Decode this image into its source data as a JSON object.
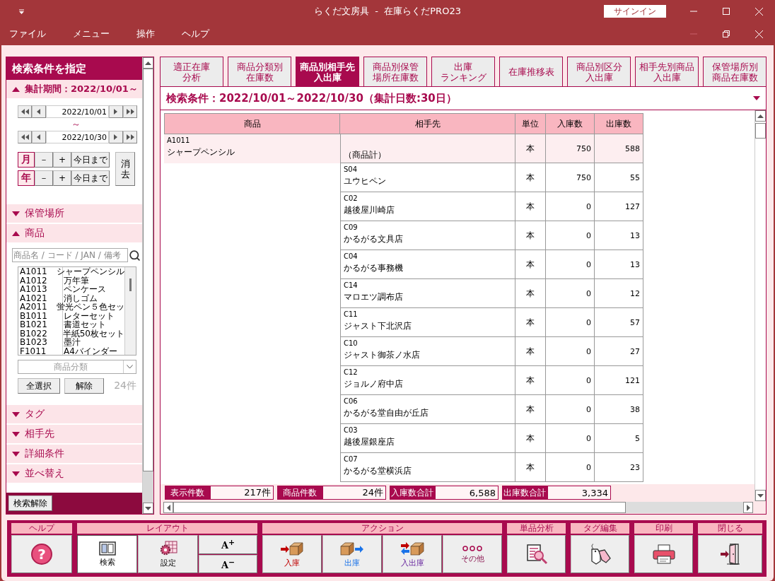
{
  "window": {
    "title": "らくだ文房具  -  在庫らくだPRO23",
    "signin": "サインイン"
  },
  "menu": [
    "ファイル",
    "メニュー",
    "操作",
    "ヘルプ"
  ],
  "sidebar": {
    "title": "検索条件を指定",
    "period": {
      "label": "集計期間：2022/10/01～",
      "expanded": true,
      "from": "2022/10/01",
      "separator": "～",
      "to": "2022/10/30",
      "rows": [
        {
          "label": "月",
          "minus": "－",
          "plus": "+",
          "today": "今日まで"
        },
        {
          "label": "年",
          "minus": "－",
          "plus": "+",
          "today": "今日まで"
        }
      ],
      "clear": "消去"
    },
    "storage": {
      "label": "保管場所",
      "expanded": false
    },
    "product": {
      "label": "商品",
      "expanded": true,
      "placeholder": "商品名 / コード / JAN / 備考",
      "items": [
        {
          "code": "A1011",
          "name": "シャープペンシル"
        },
        {
          "code": "A1012",
          "name": "万年筆"
        },
        {
          "code": "A1013",
          "name": "ペンケース"
        },
        {
          "code": "A1021",
          "name": "消しゴム"
        },
        {
          "code": "A2011",
          "name": "蛍光ペン５色セッ"
        },
        {
          "code": "B1011",
          "name": "レターセット"
        },
        {
          "code": "B1021",
          "name": "書道セット"
        },
        {
          "code": "B1022",
          "name": "半紙50枚セット"
        },
        {
          "code": "B1023",
          "name": "墨汁"
        },
        {
          "code": "F1011",
          "name": "A4バインダー"
        }
      ],
      "category_placeholder": "商品分類",
      "select_all": "全選択",
      "deselect": "解除",
      "count": "24件"
    },
    "more_sections": [
      {
        "label": "タグ",
        "expanded": false
      },
      {
        "label": "相手先",
        "expanded": false
      },
      {
        "label": "詳細条件",
        "expanded": false
      },
      {
        "label": "並べ替え",
        "expanded": false
      }
    ],
    "clear_search": "検索解除"
  },
  "tabs": [
    {
      "lines": [
        "適正在庫",
        "分析"
      ],
      "selected": false
    },
    {
      "lines": [
        "商品分類別",
        "在庫数"
      ],
      "selected": false
    },
    {
      "lines": [
        "商品別相手先",
        "入出庫"
      ],
      "selected": true
    },
    {
      "lines": [
        "商品別保管",
        "場所在庫数"
      ],
      "selected": false
    },
    {
      "lines": [
        "出庫",
        "ランキング"
      ],
      "selected": false
    },
    {
      "lines": [
        "在庫推移表"
      ],
      "selected": false
    },
    {
      "lines": [
        "商品別区分",
        "入出庫"
      ],
      "selected": false
    },
    {
      "lines": [
        "相手先別商品",
        "入出庫"
      ],
      "selected": false
    },
    {
      "lines": [
        "保管場所別",
        "商品在庫数"
      ],
      "selected": false
    }
  ],
  "condition": "検索条件：2022/10/01～2022/10/30（集計日数:30日）",
  "table": {
    "columns": [
      "商品",
      "相手先",
      "単位",
      "入庫数",
      "出庫数"
    ],
    "rows": [
      {
        "kind": "total",
        "product_code": "A1011",
        "product_name": "シャープペンシル",
        "partner_name": "（商品計）",
        "unit": "本",
        "in": "750",
        "out": "588"
      },
      {
        "kind": "partner",
        "partner_code": "S04",
        "partner_name": "ユウヒペン",
        "unit": "本",
        "in": "750",
        "out": "55"
      },
      {
        "kind": "partner",
        "partner_code": "C02",
        "partner_name": "越後屋川崎店",
        "unit": "本",
        "in": "0",
        "out": "127"
      },
      {
        "kind": "partner",
        "partner_code": "C09",
        "partner_name": "かるがる文具店",
        "unit": "本",
        "in": "0",
        "out": "13"
      },
      {
        "kind": "partner",
        "partner_code": "C04",
        "partner_name": "かるがる事務機",
        "unit": "本",
        "in": "0",
        "out": "13"
      },
      {
        "kind": "partner",
        "partner_code": "C14",
        "partner_name": "マロエツ調布店",
        "unit": "本",
        "in": "0",
        "out": "12"
      },
      {
        "kind": "partner",
        "partner_code": "C11",
        "partner_name": "ジャスト下北沢店",
        "unit": "本",
        "in": "0",
        "out": "57"
      },
      {
        "kind": "partner",
        "partner_code": "C10",
        "partner_name": "ジャスト御茶ノ水店",
        "unit": "本",
        "in": "0",
        "out": "27"
      },
      {
        "kind": "partner",
        "partner_code": "C12",
        "partner_name": "ジョルノ府中店",
        "unit": "本",
        "in": "0",
        "out": "121"
      },
      {
        "kind": "partner",
        "partner_code": "C06",
        "partner_name": "かるがる堂自由が丘店",
        "unit": "本",
        "in": "0",
        "out": "38"
      },
      {
        "kind": "partner",
        "partner_code": "C03",
        "partner_name": "越後屋銀座店",
        "unit": "本",
        "in": "0",
        "out": "5"
      },
      {
        "kind": "partner",
        "partner_code": "C07",
        "partner_name": "かるがる堂横浜店",
        "unit": "本",
        "in": "0",
        "out": "23"
      }
    ]
  },
  "summary": [
    {
      "label": "表示件数",
      "value": "217件"
    },
    {
      "label": "商品件数",
      "value": "24件"
    },
    {
      "label": "入庫数合計",
      "value": "6,588"
    },
    {
      "label": "出庫数合計",
      "value": "3,334"
    }
  ],
  "toolbar": [
    {
      "title": "ヘルプ",
      "buttons": [
        {
          "kind": "help",
          "glyph": "?"
        }
      ]
    },
    {
      "title": "レイアウト",
      "buttons": [
        {
          "kind": "layout",
          "label": "検索",
          "selected": true
        },
        {
          "kind": "settings",
          "label": "設定",
          "selected": false
        },
        {
          "kind": "font",
          "increase": "A$^{+}$",
          "decrease": "A$^{−}$"
        }
      ]
    },
    {
      "title": "アクション",
      "buttons": [
        {
          "kind": "in",
          "label": "入庫"
        },
        {
          "kind": "out",
          "label": "出庫"
        },
        {
          "kind": "inout",
          "label": "入出庫"
        },
        {
          "kind": "more",
          "label": "その他"
        }
      ]
    },
    {
      "title": "単品分析",
      "buttons": [
        {
          "kind": "analyze"
        }
      ]
    },
    {
      "title": "タグ編集",
      "buttons": [
        {
          "kind": "tag"
        }
      ]
    },
    {
      "title": "印刷",
      "buttons": [
        {
          "kind": "print"
        }
      ]
    },
    {
      "title": "閉じる",
      "buttons": [
        {
          "kind": "close"
        }
      ]
    }
  ]
}
